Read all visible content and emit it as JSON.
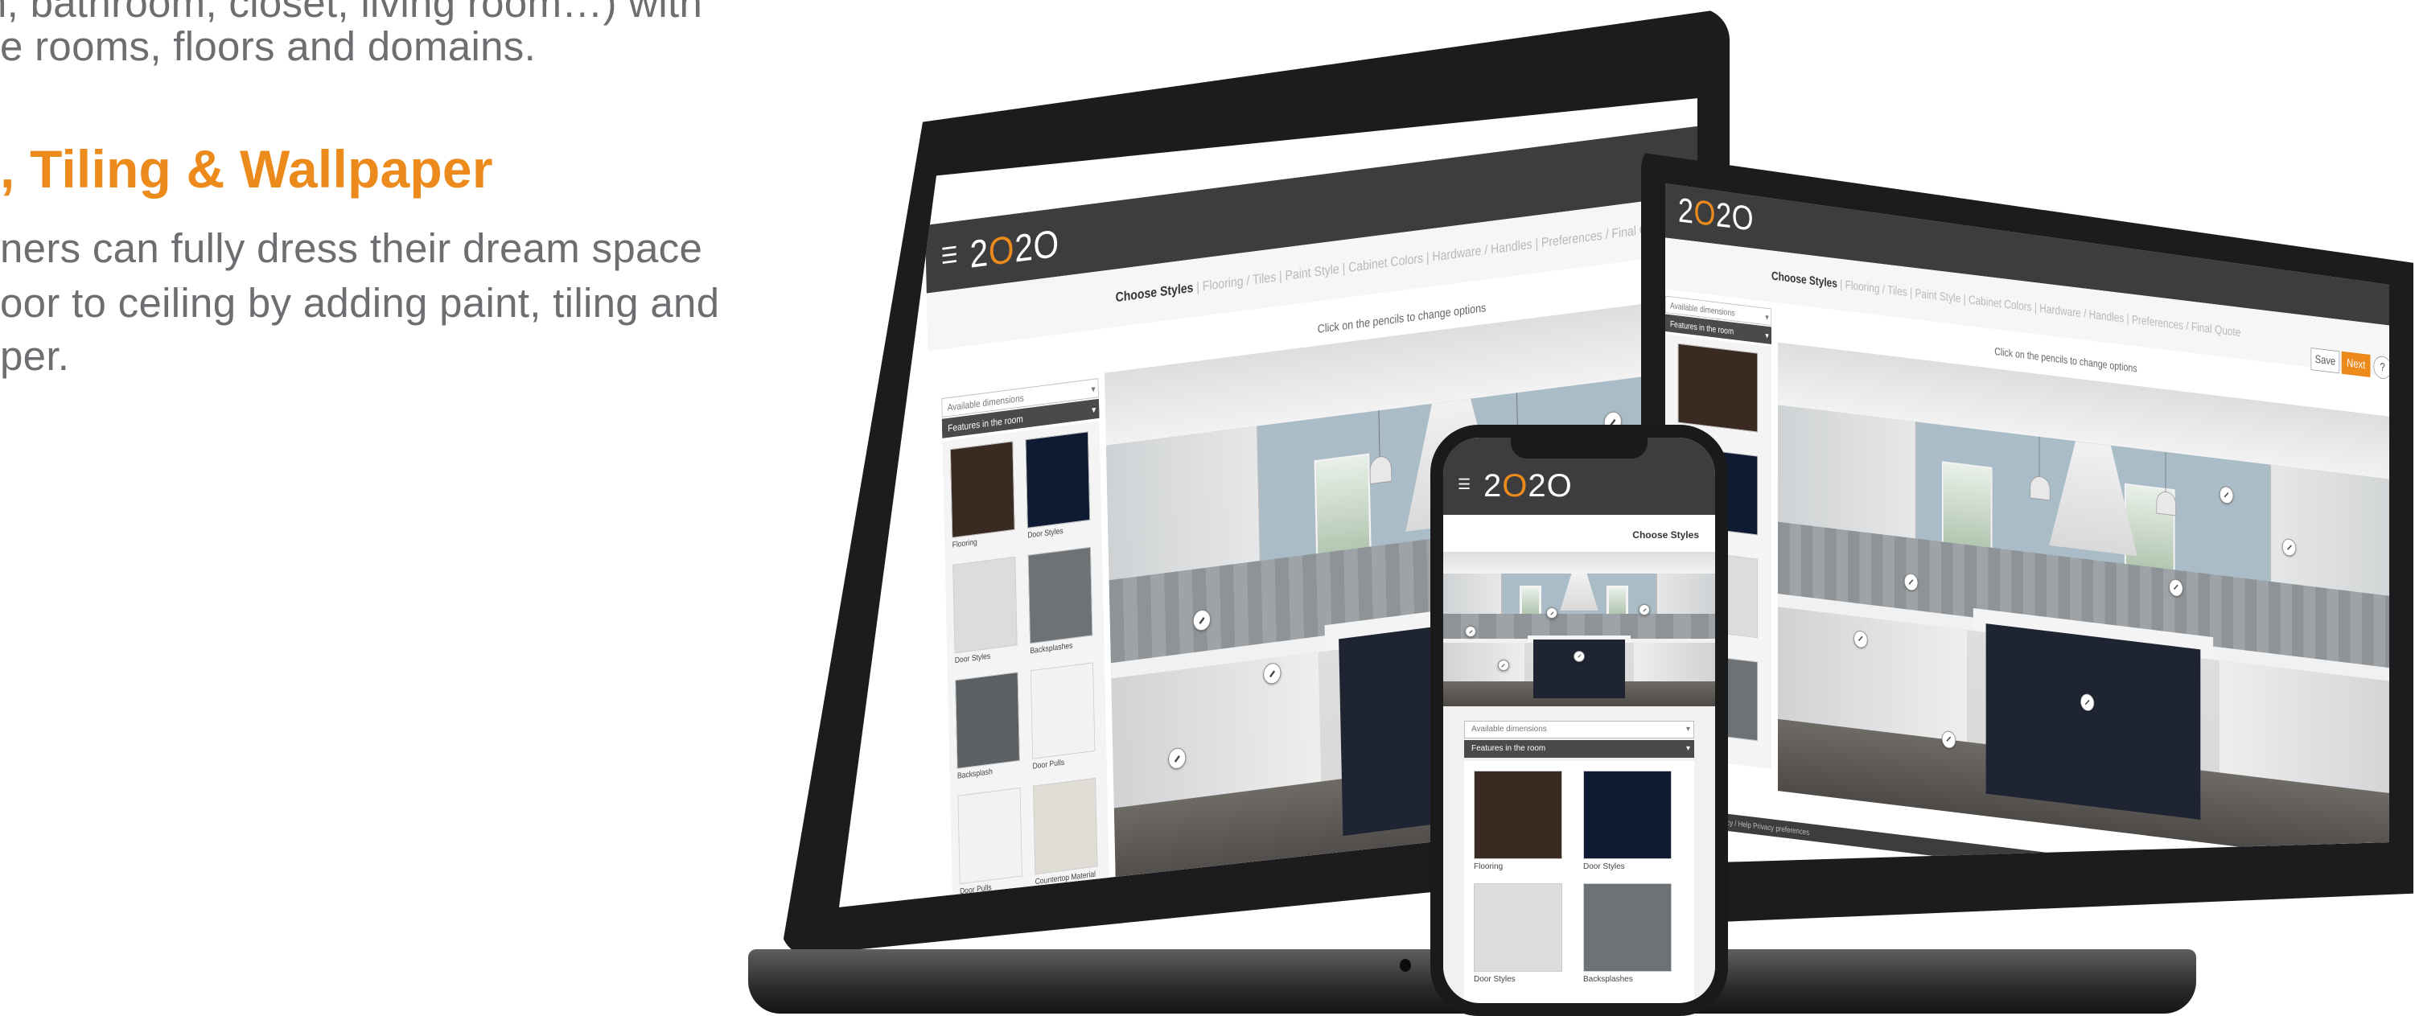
{
  "copy": {
    "line1": "n, bathroom, closet, living room…) with",
    "line2": "e rooms, floors and domains.",
    "heading": ", Tiling & Wallpaper",
    "line3": "ners can fully dress their dream space",
    "line4": "oor to ceiling by adding paint, tiling and",
    "line5": "per."
  },
  "app": {
    "logo_pre": "2",
    "logo_o": "O",
    "logo_post": "2O",
    "menu_icon": "hamburger-icon",
    "steps": [
      "Choose Styles",
      "Flooring / Tiles",
      "Paint Style",
      "Cabinet Colors",
      "Hardware / Handles",
      "Preferences / Final Quote"
    ],
    "save_label": "Save",
    "next_label": "Next",
    "help_label": "?",
    "hint": "Click on the pencils to change options",
    "dropdown_available": "Available dimensions",
    "dropdown_features": "Features in the room",
    "swatches": [
      {
        "label": "Flooring",
        "color": "#3a2a22"
      },
      {
        "label": "Door Styles",
        "color": "#0f1a33"
      },
      {
        "label": "Door Styles",
        "color": "#dcdcdc"
      },
      {
        "label": "Backsplashes",
        "color": "#6d7276"
      },
      {
        "label": "Backsplash",
        "color": "#5b6064"
      },
      {
        "label": "Door Pulls",
        "color": "#f2f2f2"
      },
      {
        "label": "Door Pulls",
        "color": "#f2f2f2"
      },
      {
        "label": "Countertop Material",
        "color": "#e0ddd6"
      }
    ],
    "footer": "Terms of use   Privacy / Help   Privacy preferences",
    "phone_title": "Choose Styles"
  },
  "colors": {
    "accent": "#ec8b1c",
    "appbar": "#3d3d3f",
    "text": "#6d6e71"
  }
}
